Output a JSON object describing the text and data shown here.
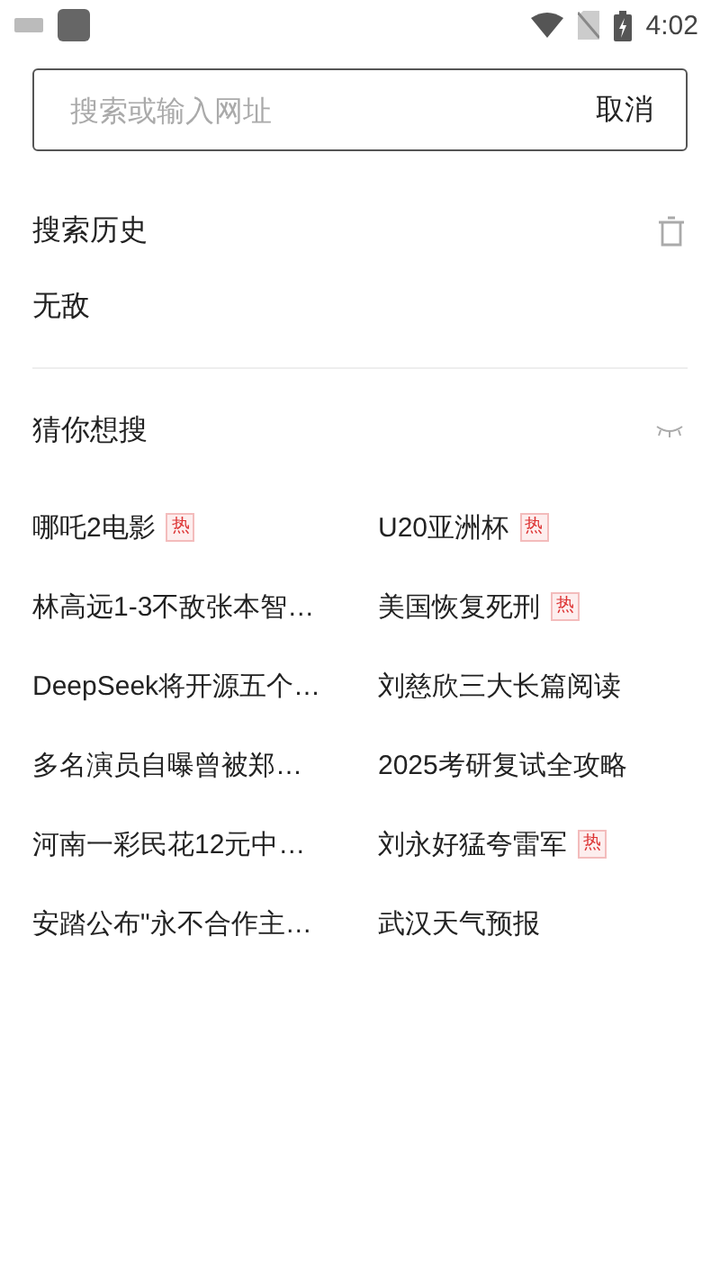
{
  "status_bar": {
    "time": "4:02"
  },
  "search": {
    "placeholder": "搜索或输入网址",
    "cancel": "取消"
  },
  "history": {
    "title": "搜索历史",
    "items": [
      "无敌"
    ]
  },
  "suggestions": {
    "title": "猜你想搜",
    "items": [
      {
        "text": "哪吒2电影",
        "badge": "热"
      },
      {
        "text": "U20亚洲杯",
        "badge": "热"
      },
      {
        "text": "林高远1-3不敌张本智…"
      },
      {
        "text": "美国恢复死刑",
        "badge": "热"
      },
      {
        "text": "DeepSeek将开源五个…"
      },
      {
        "text": "刘慈欣三大长篇阅读"
      },
      {
        "text": "多名演员自曝曾被郑…"
      },
      {
        "text": "2025考研复试全攻略"
      },
      {
        "text": "河南一彩民花12元中…"
      },
      {
        "text": "刘永好猛夸雷军",
        "badge": "热"
      },
      {
        "text": "安踏公布\"永不合作主…"
      },
      {
        "text": "武汉天气预报"
      }
    ]
  }
}
